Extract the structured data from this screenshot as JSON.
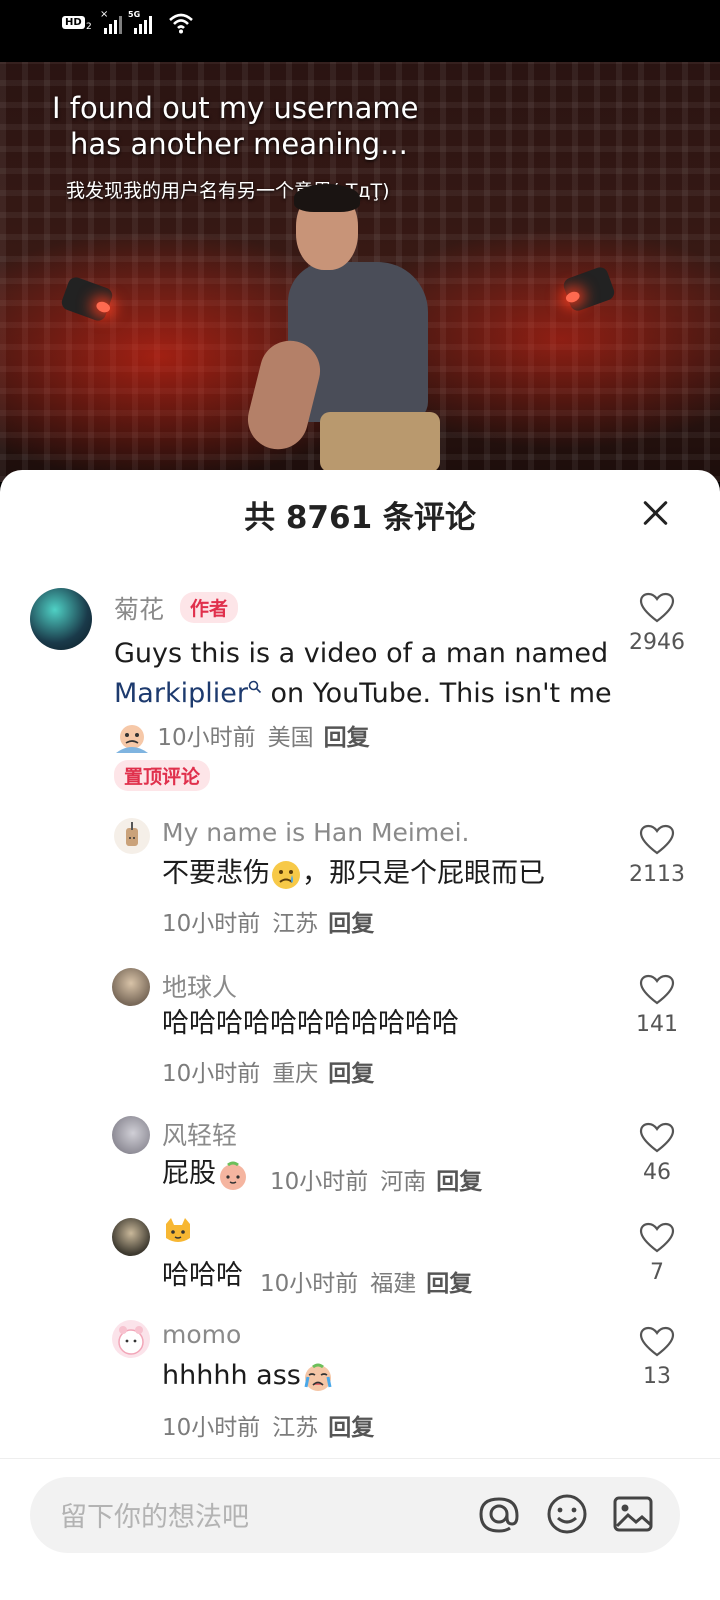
{
  "status_bar": {
    "hd_label": "HD",
    "hd_sub": "2",
    "signal_tag": "5G",
    "icons": [
      "hd-icon",
      "signal-icon",
      "5g-signal-icon",
      "wifi-icon"
    ]
  },
  "video": {
    "caption_en": [
      "I found out my username",
      "has another meaning..."
    ],
    "caption_cn": "我发现我的用户名有另一个意思(;ŢдŢ)"
  },
  "sheet": {
    "title": "共 8761 条评论",
    "close_icon": "close-icon"
  },
  "comments": [
    {
      "user": "菊花",
      "author_tag": "作者",
      "text_line1": "Guys this is a video of a man named",
      "text_link": "Markiplier",
      "text_line2_rest": " on YouTube. This isn't me",
      "time": "10小时前",
      "location": "美国",
      "reply": "回复",
      "pinned_tag": "置顶评论",
      "likes": "2946"
    },
    {
      "user": "My name is Han Meimei.",
      "text": "不要悲伤",
      "text_rest": "，那只是个屁眼而已",
      "time": "10小时前",
      "location": "江苏",
      "reply": "回复",
      "likes": "2113"
    },
    {
      "user": "地球人",
      "text": "哈哈哈哈哈哈哈哈哈哈哈",
      "time": "10小时前",
      "location": "重庆",
      "reply": "回复",
      "likes": "141"
    },
    {
      "user": "风轻轻",
      "text": "屁股",
      "time": "10小时前",
      "location": "河南",
      "reply": "回复",
      "likes": "46"
    },
    {
      "user_icon": "cat-emoji-icon",
      "text": "哈哈哈",
      "time": "10小时前",
      "location": "福建",
      "reply": "回复",
      "likes": "7"
    },
    {
      "user": "momo",
      "text": "hhhhh ass",
      "time": "10小时前",
      "location": "江苏",
      "reply": "回复",
      "likes": "13"
    }
  ],
  "input_bar": {
    "placeholder": "留下你的想法吧",
    "icons": [
      "at-icon",
      "emoji-icon",
      "image-icon"
    ]
  },
  "colors": {
    "accent": "#e0304c",
    "tag_bg": "#fde5e8",
    "text_primary": "#1c1c1c",
    "text_secondary": "#8a8a8a"
  }
}
